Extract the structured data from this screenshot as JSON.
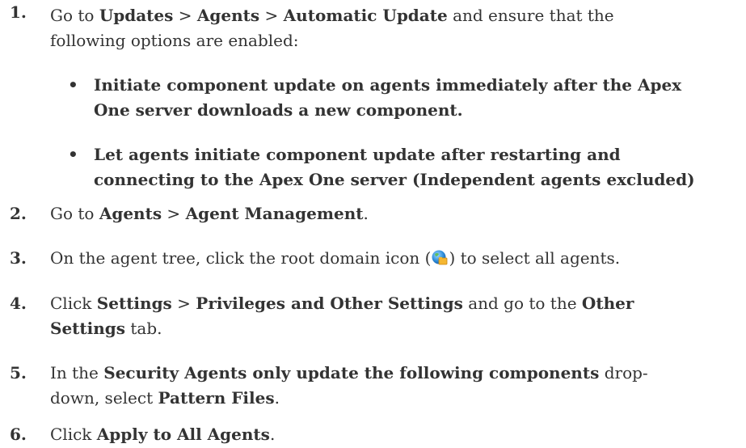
{
  "steps": [
    {
      "num": "1.",
      "line1": {
        "a": "Go to ",
        "b1": "Updates",
        "s1": " > ",
        "b2": "Agents",
        "s2": " > ",
        "b3": "Automatic Update",
        "c": " and ensure that the"
      },
      "line2": "following options are enabled:",
      "bullets": [
        {
          "symbol": "•",
          "line1": "Initiate component update on agents immediately after the Apex",
          "line2": "One server downloads a new component."
        },
        {
          "symbol": "•",
          "line1": "Let agents initiate component update after restarting and",
          "line2": "connecting to the Apex One server (Independent agents excluded)"
        }
      ]
    },
    {
      "num": "2.",
      "a": "Go to ",
      "b1": "Agents",
      "s1": " > ",
      "b2": "Agent Management",
      "c": "."
    },
    {
      "num": "3.",
      "a": "On the agent tree, click the root domain icon (",
      "icon": "root-domain-globe-icon",
      "c": ") to select all agents."
    },
    {
      "num": "4.",
      "line1": {
        "a": "Click ",
        "b1": "Settings",
        "s1": " > ",
        "b2": "Privileges and Other Settings",
        "m": " and go to the ",
        "b3": "Other"
      },
      "line2": {
        "b": "Settings",
        "c": " tab."
      }
    },
    {
      "num": "5.",
      "line1": {
        "a": "In the ",
        "b1": "Security Agents only update the following components",
        "c": " drop-"
      },
      "line2": {
        "a": "down, select ",
        "b": "Pattern Files",
        "c": "."
      }
    },
    {
      "num": "6.",
      "a": "Click ",
      "b": "Apply to All Agents",
      "c": "."
    }
  ]
}
